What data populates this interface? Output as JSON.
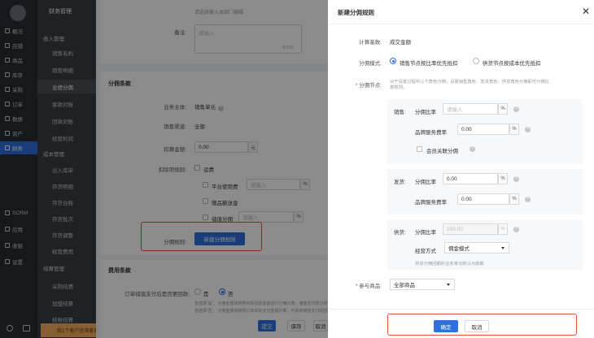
{
  "nav": {
    "items": [
      {
        "label": "概况"
      },
      {
        "label": "店铺"
      },
      {
        "label": "商品"
      },
      {
        "label": "库存"
      },
      {
        "label": "采购"
      },
      {
        "label": "订单"
      },
      {
        "label": "数据"
      },
      {
        "label": "资产"
      },
      {
        "label": "财务"
      }
    ],
    "bottom": [
      {
        "label": "SCRM"
      },
      {
        "label": "应用"
      },
      {
        "label": "收银"
      },
      {
        "label": "设置"
      }
    ]
  },
  "subnav": {
    "title": "财务管理",
    "items": [
      {
        "label": "收入管理"
      },
      {
        "label": "销售毛利"
      },
      {
        "label": "销售明细"
      },
      {
        "label": "业绩分佣"
      },
      {
        "label": "客款对账"
      },
      {
        "label": "回款对账"
      },
      {
        "label": "经营利润"
      },
      {
        "label": "成本管理"
      },
      {
        "label": "出入库单"
      },
      {
        "label": "存货明细"
      },
      {
        "label": "存货台账"
      },
      {
        "label": "存货批次"
      },
      {
        "label": "存货调整"
      },
      {
        "label": "经营费用"
      },
      {
        "label": "结算管理"
      },
      {
        "label": "采购结费"
      },
      {
        "label": "加盟结算"
      },
      {
        "label": "技账结算"
      }
    ],
    "notice": "我1个客户咨询客服议"
  },
  "main": {
    "top_hint": "请选择输入本部门编辑",
    "remark_label": "备注:",
    "remark_placeholder": "请输入",
    "remark_count": "0/100",
    "section_title": "分佣条款",
    "rows": {
      "subject_label": "业务主体:",
      "subject_value": "销售单元",
      "channel_label": "销售渠道:",
      "channel_value": "全部",
      "deduct_label": "扣算金额:",
      "deduct_value": "0.00",
      "deduct_unit": "元",
      "items_label": "扣除项规则:",
      "opt1": "运费",
      "opt2": "平台使用费",
      "opt2_placeholder": "请输入",
      "opt3": "赠品额送金",
      "opt4": "储值分佣",
      "opt4_placeholder": "请输入",
      "pct": "%",
      "rule_label": "分佣规则:",
      "rule_button": "新建分佣规则"
    },
    "fee_title": "费用条款",
    "fee_row_label": "订单储值支付后是否要回款:",
    "fee_opt_no": "是",
    "fee_opt_yes": "否",
    "fee_note": "若选择“是”，分佣金额将按照实际回款金额进行分佣计算，储值支付部分将不计入分佣金额计算",
    "fee_note2": "若选择“否”，分佣金额将按照订单实际支付金额计算，不考虑储值支付的回款状态",
    "footer_ok": "提交",
    "footer_save": "保存",
    "footer_cancel": "取消"
  },
  "drawer": {
    "title": "新建分佣规则",
    "base_label": "计算基数:",
    "base_value": "成交金额",
    "mode_label": "分佣模式:",
    "mode_opt1": "销售节点按比率优先抵扣",
    "mode_opt2": "供货节点按成本优先抵扣",
    "node_label": "分佣节点:",
    "node_hint": "对于设置过程中三个角色分佣，设置销售角色、发货角色、供货角色分佣即可分佣比率规则。",
    "sales": {
      "label": "销售:",
      "ratio_label": "分佣比率",
      "ratio_placeholder": "请输入",
      "brand_label": "品牌服务费率",
      "brand_value": "0.00",
      "member_label": "会员关联分佣"
    },
    "ship": {
      "label": "发货:",
      "ratio_label": "分佣比率",
      "ratio_value": "0.00",
      "brand_label": "品牌服务费率",
      "brand_value": "0.00"
    },
    "supply": {
      "label": "供货:",
      "ratio_label": "分佣比率",
      "ratio_value": "100.00",
      "mode_label": "经营方式",
      "mode_value": "佣金模式",
      "note": "供货分佣回额的业务单元默认为底薪"
    },
    "pct": "%",
    "goods_label": "参与商品:",
    "goods_value": "全部商品",
    "ok": "确定",
    "cancel": "取消",
    "colors": {
      "primary": "#2f6fe0",
      "highlight": "#e8523f"
    }
  }
}
